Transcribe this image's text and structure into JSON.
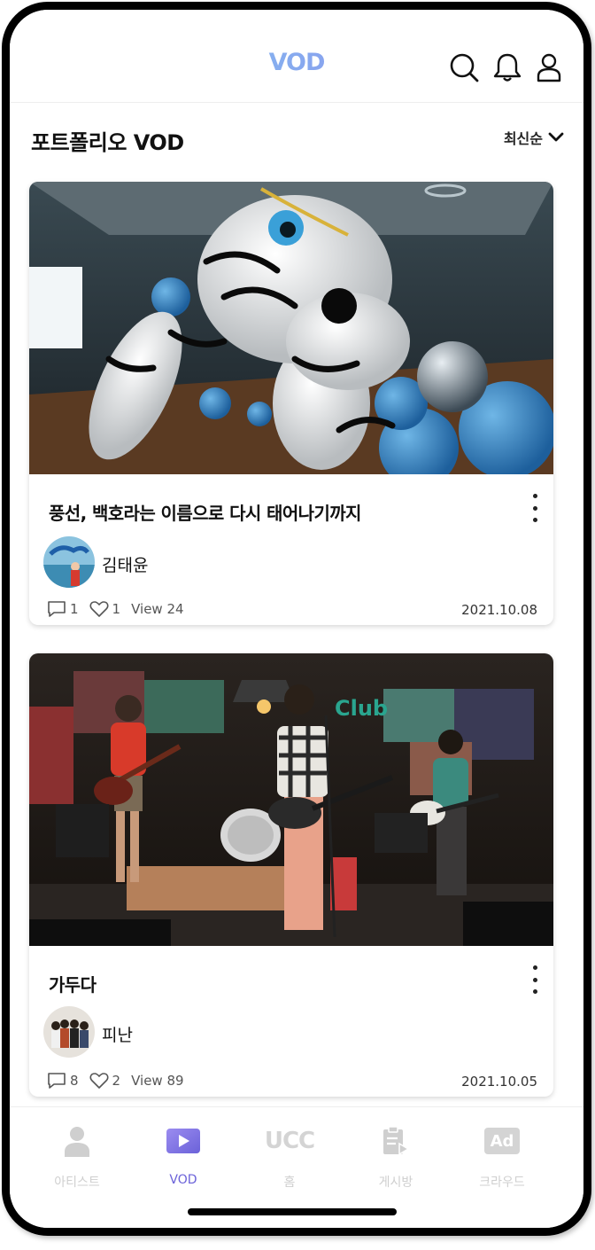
{
  "header": {
    "logo": "VOD",
    "icons": [
      "search-icon",
      "bell-icon",
      "user-icon"
    ]
  },
  "section": {
    "title": "포트폴리오 VOD",
    "sort_label": "최신순",
    "accent": "#a8ebf2"
  },
  "videos": [
    {
      "title": "풍선, 백호라는 이름으로 다시 태어나기까지",
      "author": "김태윤",
      "comments": "1",
      "likes": "1",
      "views": "View 24",
      "date": "2021.10.08"
    },
    {
      "title": "가두다",
      "author": "피난",
      "comments": "8",
      "likes": "2",
      "views": "View 89",
      "date": "2021.10.05"
    }
  ],
  "bottom_nav": {
    "items": [
      {
        "label": "아티스트",
        "icon": "person-icon"
      },
      {
        "label": "VOD",
        "icon": "play-icon",
        "active": true
      },
      {
        "label": "홈",
        "icon": "ucc-icon",
        "icon_text": "UCC"
      },
      {
        "label": "게시방",
        "icon": "board-icon"
      },
      {
        "label": "크라우드",
        "icon": "ad-icon",
        "icon_text": "Ad"
      }
    ],
    "active_color": "#6b62d9",
    "inactive_color": "#cfcfcf"
  }
}
